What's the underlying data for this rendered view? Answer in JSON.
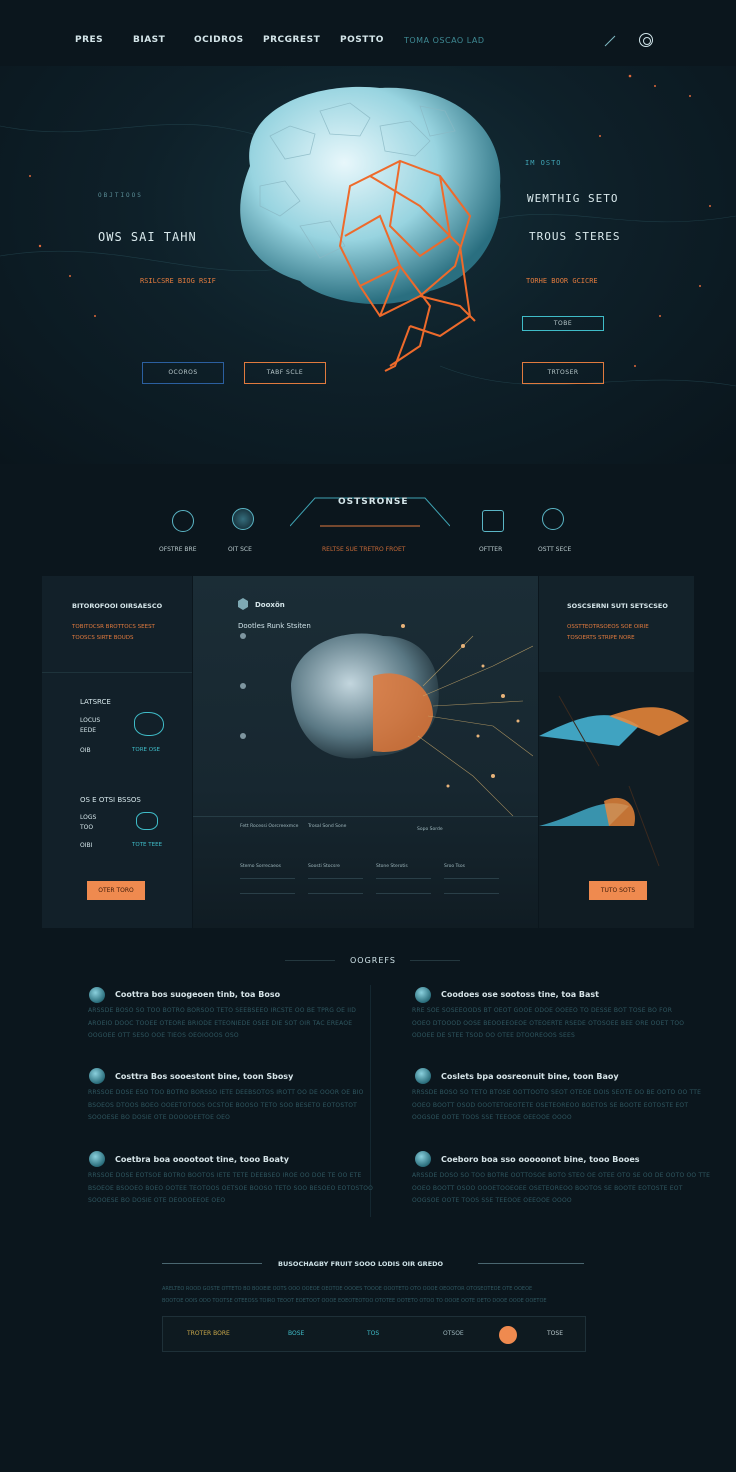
{
  "nav": {
    "items": [
      "PRES",
      "BIAST",
      "OCIDROS",
      "PRCGREST",
      "POSTTO"
    ],
    "tagline": "TOMA OSCAO LAD",
    "icons": [
      "feather-icon",
      "gear-icon"
    ]
  },
  "hero": {
    "left_sub": "OBJTIOOS",
    "left_title": "OWS SAI TAHN",
    "left_accent": "RSILCSRE BIOG RSIF",
    "right_small": "IM OSTO",
    "right_title1": "WEMTHIG SETO",
    "right_title2": "TROUS STERES",
    "right_accent": "TORHE BOOR GCICRE",
    "btn_right_small": "TOBE",
    "btn1": "OCOROS",
    "btn2": "TABF SCLE",
    "btn3": "TRTOSER"
  },
  "services": {
    "title": "OSTSRONSE",
    "orange_sub": "RELTSE SUE TRETRO FROET",
    "labels": [
      "OFSTRE BRE",
      "OIT SCE",
      "OFTTER",
      "OSTT SECE"
    ]
  },
  "panel": {
    "left": {
      "title": "BITOROFOOI OIRSAESCO",
      "accent1": "TOBITOCSR BROTTOCS SEEST",
      "accent2": "TOOSCS SIRTE BOUDS",
      "block1_heading": "LATSRCE",
      "block1_line1": "LOCUS",
      "block1_line2": "EEDE",
      "block1_left": "OIB",
      "block1_right": "TORE OSE",
      "block2_heading": "OS E OTSI BSSOS",
      "block2_line1": "LOGS",
      "block2_line2": "TOO",
      "block2_left": "OIBI",
      "block2_right": "TOTE TEEE",
      "button": "OTER TORO"
    },
    "center": {
      "logo_text": "Dooxön",
      "subtitle": "Dootles Runk Stsiten",
      "cols": [
        "Fett Rocessi Oorcreexmce",
        "Trosal Sond Sone",
        "Sopo Sorde"
      ],
      "row2": [
        "Stemo Sorrecaeos",
        "Soosti Stocsre",
        "Stone Sterotis",
        "Sroo Tsos"
      ]
    },
    "right": {
      "title": "SOSCSERNI SUTI SETSCSEO",
      "accent1": "OSSTTEOTRSOEOS SOE OIRIE",
      "accent2": "TOSOERTS STRIPE NORE",
      "button": "TUTO SOTS"
    }
  },
  "features": {
    "title": "OOGREFS",
    "items": [
      {
        "title": "Coottra bos suogeoen tinb, toa Boso",
        "lines": [
          "ARSSDE BOSO SO TOO BOTRO BORSOO TETO SEEBSEEO IRCSTE OO BE TPRG OE IID",
          "AROEIO DOOC TOOEE OTEORE BRIODE ETEONIEDE OSEE DIE SOT OIR TAC EREAOE",
          "OOGOEE OTT SESO OOE TIEOS OEOIOOOS OSO"
        ]
      },
      {
        "title": "Coodoes ose sootoss tine, toa Bast",
        "lines": [
          "RRE SOE SOSEEOODS BT OEOT GOOE ODOE OOEEO TO DESSE BOT TOSE BO FOR",
          "OOEO DTOOOD OOSE BEOOEEOEOE OTEOERTE RSEDE OTOSOEE BEE ORE OOET TOO",
          "ODOEE DE STEE TSOD OO OTEE DTOOREOOS SEES"
        ]
      },
      {
        "title": "Costtra Bos sooestont bine, toon Sbosy",
        "lines": [
          "RRSSOE DOSE ESO TOO BOTRO BORSSO IETE DEEBSOTOS IROTT OO DE OOOR OE BIO",
          "BSOEOS DTOOS BOEO OOEETOTOOS OCSTOE BOOSO TETO SOO BESETO EOTOSTOT",
          "SOOOESE BO DOSIE OTE DOOOOEETOE OEO"
        ]
      },
      {
        "title": "Coslets bpa oosreonuit bine, toon Baoy",
        "lines": [
          "RRSSDE BOSO SO TETO BTOSE OOTTOOTO SEOT OTEOE DOIS SEOTE OO BE OOTO OO TTE",
          "OOEO BOOTT OSOD OOOTETOEOTETE OSETEOREOO BOETOS SE BOOTE EOTOSTE EOT",
          "OOGSOE OOTE TOOS SSE TEEOOE OEEOOE OOOO"
        ]
      },
      {
        "title": "Coetbra boa ooootoot tine, tooo Boaty",
        "lines": [
          "RRSSOE DOSE EOTSOE BOTRO BOOTOS IETE TETE DEEBSEO IROE OO DOE TE OO ETE",
          "BSOEOE BSOOEO BOEO OOTEE TEOTOOS OETSOE BOOSO TETO SOO BESOEO EOTOSTOO",
          "SOOOESE BO DOSIE OTE DEOOOEEOE OEO"
        ]
      },
      {
        "title": "Coeboro boa sso ooooonot bine, tooo Booes",
        "lines": [
          "ARSSDE DOSO SO TOO BOTRE OOTTOSOE BOTO STEO OE OTEE OTO SE OO DE OOTO OO TTE",
          "OOEO BOOTT OSOO OOOETOOEOEE OSETEOREOO BOOTOS SE BOOTE EOTOSTE EOT",
          "OOGSOE OOTE TOOS SSE TEEOOE OEEOOE OOOO"
        ]
      }
    ]
  },
  "newsletter": {
    "title": "BUSOCHAGBY FRUIT SOOO LODIS OIR GREDO",
    "lines": [
      "ARELTEO ROOD GOSTE OTTETO BO BOOEIE OOTS OOO OOEOE OEOTOE OOOES TOOOE OOOTETO OTO OOOE OEOOTOR OTOSEOTEOE OTE OOEOE",
      "BOOTOE OOIS ODO TOOTSE OTEEOSS TOIRO TEOOT EOETOOT OOOE EOEOTEOTOO OTOTEE OOTETO OTOO TO OOOE OOTE OETO DOOE OOOE OOETOE"
    ],
    "bar_items": [
      "TROTER BORE",
      "BOSE",
      "TOS",
      "OTSOE",
      "TOSE"
    ]
  }
}
